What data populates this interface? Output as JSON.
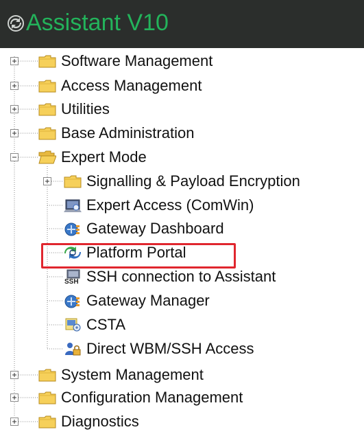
{
  "app": {
    "title": "Assistant V10"
  },
  "tree": {
    "software_management": "Software Management",
    "access_management": "Access Management",
    "utilities": "Utilities",
    "base_administration": "Base Administration",
    "expert_mode": "Expert Mode",
    "expert_children": {
      "signalling": "Signalling & Payload Encryption",
      "expert_access": "Expert Access (ComWin)",
      "gateway_dashboard": "Gateway Dashboard",
      "platform_portal": "Platform Portal",
      "ssh_connection": "SSH connection to Assistant",
      "gateway_manager": "Gateway Manager",
      "csta": "CSTA",
      "direct_wbm": "Direct WBM/SSH Access"
    },
    "system_management": "System Management",
    "configuration_management": "Configuration Management",
    "diagnostics": "Diagnostics"
  },
  "icons": {
    "ssh_text": "SSH"
  },
  "colors": {
    "header_bg": "#2b2e2c",
    "title_green": "#23b35b",
    "highlight": "#e0262e",
    "folder": "#f6d05a"
  }
}
